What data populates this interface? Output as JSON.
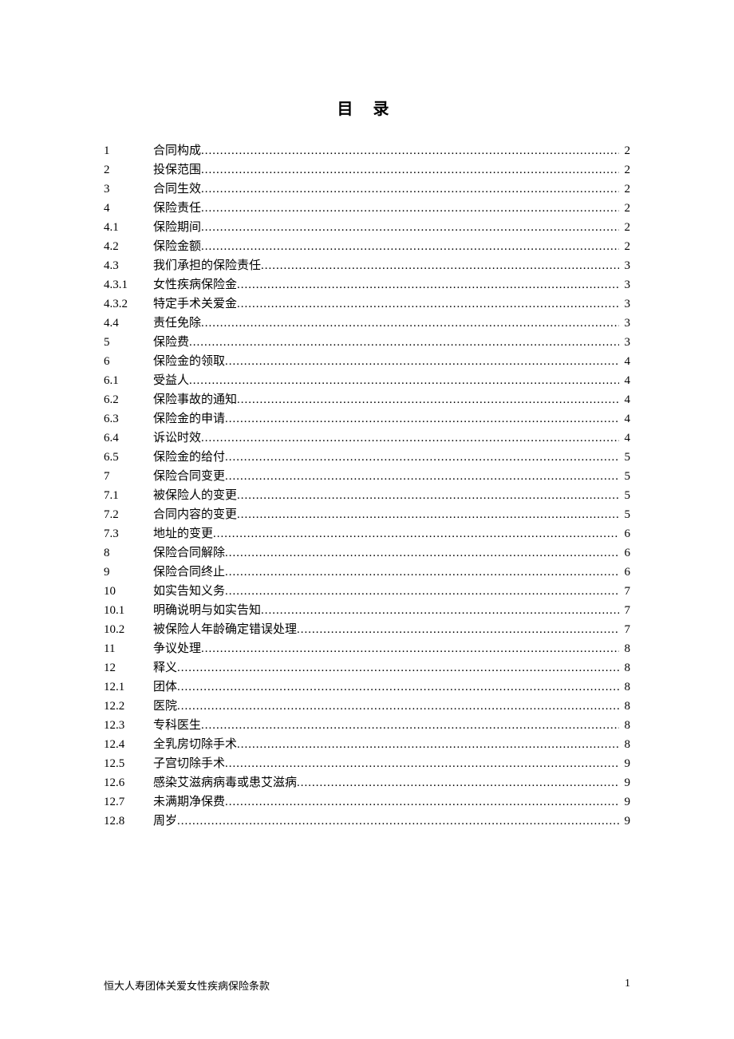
{
  "title": "目 录",
  "footer": {
    "left": "恒大人寿团体关爱女性疾病保险条款",
    "page": "1"
  },
  "toc": [
    {
      "num": "1",
      "label": "合同构成",
      "page": "2",
      "level": 1
    },
    {
      "num": "2",
      "label": "投保范围",
      "page": "2",
      "level": 1
    },
    {
      "num": "3",
      "label": "合同生效",
      "page": "2",
      "level": 1
    },
    {
      "num": "4",
      "label": "保险责任",
      "page": "2",
      "level": 1
    },
    {
      "num": "4.1",
      "label": "保险期间",
      "page": "2",
      "level": 2
    },
    {
      "num": "4.2",
      "label": "保险金额",
      "page": "2",
      "level": 2
    },
    {
      "num": "4.3",
      "label": "我们承担的保险责任",
      "page": "3",
      "level": 2
    },
    {
      "num": "4.3.1",
      "label": "女性疾病保险金",
      "page": "3",
      "level": 2
    },
    {
      "num": "4.3.2",
      "label": "特定手术关爱金",
      "page": "3",
      "level": 2
    },
    {
      "num": "4.4",
      "label": "责任免除",
      "page": "3",
      "level": 2
    },
    {
      "num": "5",
      "label": "保险费",
      "page": "3",
      "level": 1
    },
    {
      "num": "6",
      "label": "保险金的领取",
      "page": "4",
      "level": 1
    },
    {
      "num": "6.1",
      "label": "受益人",
      "page": "4",
      "level": 2
    },
    {
      "num": "6.2",
      "label": "保险事故的通知",
      "page": "4",
      "level": 2
    },
    {
      "num": "6.3",
      "label": "保险金的申请",
      "page": "4",
      "level": 2
    },
    {
      "num": "6.4",
      "label": "诉讼时效",
      "page": "4",
      "level": 2
    },
    {
      "num": "6.5",
      "label": "保险金的给付",
      "page": "5",
      "level": 2
    },
    {
      "num": "7",
      "label": "保险合同变更",
      "page": "5",
      "level": 1
    },
    {
      "num": "7.1",
      "label": "被保险人的变更",
      "page": "5",
      "level": 2
    },
    {
      "num": "7.2",
      "label": "合同内容的变更",
      "page": "5",
      "level": 2
    },
    {
      "num": "7.3",
      "label": "地址的变更",
      "page": "6",
      "level": 2
    },
    {
      "num": "8",
      "label": "保险合同解除",
      "page": "6",
      "level": 1
    },
    {
      "num": "9",
      "label": "保险合同终止",
      "page": "6",
      "level": 1
    },
    {
      "num": "10",
      "label": "如实告知义务",
      "page": "7",
      "level": 2
    },
    {
      "num": "10.1",
      "label": "明确说明与如实告知",
      "page": "7",
      "level": 2
    },
    {
      "num": "10.2",
      "label": "被保险人年龄确定错误处理",
      "page": "7",
      "level": 2
    },
    {
      "num": "11",
      "label": "争议处理",
      "page": "8",
      "level": 2
    },
    {
      "num": "12",
      "label": "释义",
      "page": "8",
      "level": 2
    },
    {
      "num": "12.1",
      "label": "团体",
      "page": "8",
      "level": 2
    },
    {
      "num": "12.2",
      "label": "医院",
      "page": "8",
      "level": 2
    },
    {
      "num": "12.3",
      "label": "专科医生",
      "page": "8",
      "level": 2
    },
    {
      "num": "12.4",
      "label": "全乳房切除手术",
      "page": "8",
      "level": 2
    },
    {
      "num": "12.5",
      "label": "子宫切除手术",
      "page": "9",
      "level": 2
    },
    {
      "num": "12.6",
      "label": "感染艾滋病病毒或患艾滋病",
      "page": "9",
      "level": 2
    },
    {
      "num": "12.7",
      "label": "未满期净保费",
      "page": "9",
      "level": 2
    },
    {
      "num": "12.8",
      "label": "周岁",
      "page": "9",
      "level": 2
    }
  ]
}
